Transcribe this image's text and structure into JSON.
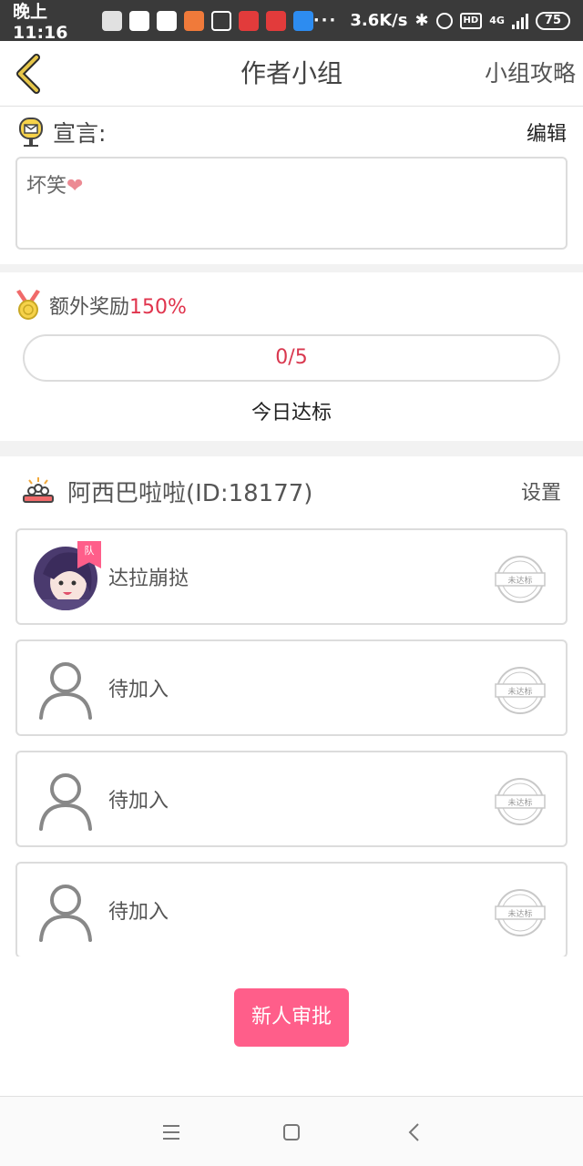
{
  "status_bar": {
    "time": "晚上11:16",
    "dots": "···",
    "net_speed": "3.6K/s",
    "hd": "HD",
    "network": "4G",
    "battery": "75"
  },
  "header": {
    "title": "作者小组",
    "right_link": "小组攻略"
  },
  "declaration": {
    "label": "宣言:",
    "edit_label": "编辑",
    "text": "坏笑",
    "emoji": "❤"
  },
  "reward": {
    "label": "额外奖励",
    "percent": "150%",
    "progress_text": "0/5",
    "progress_fraction": 0,
    "today_label": "今日达标"
  },
  "group": {
    "name": "阿西巴啦啦(ID:18177)",
    "settings_label": "设置"
  },
  "members": [
    {
      "name": "达拉崩挞",
      "leader_tag": "队",
      "status": "未达标",
      "has_photo": true
    },
    {
      "name": "待加入",
      "status": "未达标",
      "has_photo": false
    },
    {
      "name": "待加入",
      "status": "未达标",
      "has_photo": false
    },
    {
      "name": "待加入",
      "status": "未达标",
      "has_photo": false
    }
  ],
  "approve_button": "新人审批",
  "colors": {
    "accent": "#ff5e8a",
    "highlight": "#e0344d",
    "back_arrow": "#c9a825"
  }
}
